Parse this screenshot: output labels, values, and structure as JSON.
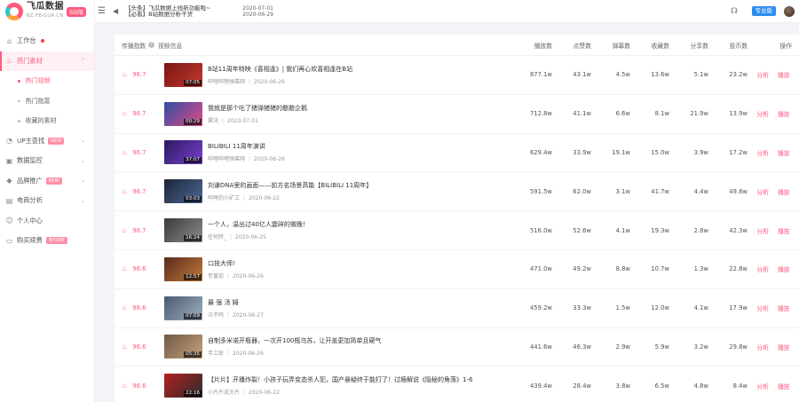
{
  "brand": {
    "name": "飞瓜数据",
    "sub": "BZ.FEIGUA.CN",
    "badge": "B站版"
  },
  "nav": [
    {
      "label": "工作台",
      "icon": "home-icon",
      "reddot": true
    },
    {
      "label": "热门素材",
      "icon": "fire-icon",
      "active": true,
      "caret": "⌃"
    },
    {
      "label": "UP主查找",
      "icon": "search-user-icon",
      "tag": "NEW",
      "caret": "⌄"
    },
    {
      "label": "数据监控",
      "icon": "monitor-icon",
      "caret": "⌄"
    },
    {
      "label": "品牌推广",
      "icon": "diamond-icon",
      "tag": "NEW",
      "caret": "⌄"
    },
    {
      "label": "电商分析",
      "icon": "cart-icon",
      "caret": "⌄"
    },
    {
      "label": "个人中心",
      "icon": "user-icon"
    },
    {
      "label": "购买续费",
      "icon": "card-icon",
      "tag": "年付8折"
    }
  ],
  "subnav": [
    "热门视频",
    "热门指富",
    "收藏的素材"
  ],
  "topbar": {
    "ticker_line1": "【头条】飞瓜数据上线新功能啦~",
    "ticker_line2": "【必看】B站数据分析干货",
    "date_line1": "2020-07-01",
    "date_line2": "2020-06-29",
    "pro_label": "专业版"
  },
  "table": {
    "headers": {
      "idx": "传播指数",
      "info": "视频信息",
      "play": "播放数",
      "like": "点赞数",
      "coin": "弹幕数",
      "fav": "收藏数",
      "share": "分享数",
      "coins": "投币数",
      "ops": "操作"
    },
    "op_analyze": "分析",
    "op_play": "播放",
    "rows": [
      {
        "idx": "96.7",
        "title": "B站11周年特映《喜相逢》| 我们再心欢喜相逢在B站",
        "author": "哔哩哔哩弹幕网",
        "date": "2020-06-26",
        "dur": "07:05",
        "play": "877.1w",
        "like": "43.1w",
        "coin": "4.5w",
        "fav": "13.6w",
        "share": "5.1w",
        "coins": "23.2w",
        "thumb": [
          "#7a1414",
          "#c23a2e"
        ]
      },
      {
        "idx": "96.7",
        "title": "我就是那个吃了猪弹猪猪的憨憨企鹅",
        "author": "翼讯",
        "date": "2020-07-01",
        "dur": "00:29",
        "play": "712.8w",
        "like": "41.1w",
        "coin": "6.6w",
        "fav": "8.1w",
        "share": "21.9w",
        "coins": "13.9w",
        "thumb": [
          "#2f4fa3",
          "#e04a86"
        ]
      },
      {
        "idx": "96.7",
        "title": "BILIBILI 11周年演讲",
        "author": "哔哩哔哩弹幕网",
        "date": "2020-06-26",
        "dur": "37:07",
        "play": "629.4w",
        "like": "33.9w",
        "coin": "19.1w",
        "fav": "15.0w",
        "share": "3.9w",
        "coins": "17.2w",
        "thumb": [
          "#2a1a5e",
          "#7a3fd1"
        ]
      },
      {
        "idx": "96.7",
        "title": "刘谦DNA里的画面——前方名场景高能【BILIBILI 11周年】",
        "author": "哔哩的小矿工",
        "date": "2020-06-22",
        "dur": "03:03",
        "play": "591.5w",
        "like": "62.0w",
        "coin": "3.1w",
        "fav": "41.7w",
        "share": "4.4w",
        "coins": "49.8w",
        "thumb": [
          "#1c2436",
          "#4d6a9a"
        ]
      },
      {
        "idx": "96.7",
        "title": "一个人，温出过40亿人震碎的微晚！",
        "author": "任何转_",
        "date": "2020-06-25",
        "dur": "16:24",
        "play": "516.0w",
        "like": "52.6w",
        "coin": "4.1w",
        "fav": "19.3w",
        "share": "2.8w",
        "coins": "42.3w",
        "thumb": [
          "#3a3a3a",
          "#8d8d8d"
        ]
      },
      {
        "idx": "96.6",
        "title": "口技大师!",
        "author": "老番茄",
        "date": "2020-06-26",
        "dur": "12:57",
        "play": "471.0w",
        "like": "49.2w",
        "coin": "8.8w",
        "fav": "10.7w",
        "share": "1.3w",
        "coins": "22.8w",
        "thumb": [
          "#5a2c1c",
          "#c07a3a"
        ]
      },
      {
        "idx": "96.6",
        "title": "最 强 汤 姆",
        "author": "汪不鸣",
        "date": "2020-06-27",
        "dur": "07:09",
        "play": "459.2w",
        "like": "33.3w",
        "coin": "1.5w",
        "fav": "12.0w",
        "share": "4.1w",
        "coins": "17.9w",
        "thumb": [
          "#4a5a6e",
          "#9fb0c0"
        ]
      },
      {
        "idx": "96.6",
        "title": "自制多米诺开瓶器，一次开100瓶乌苏，让开盖更加简单且硬气",
        "author": "手工耿",
        "date": "2020-06-26",
        "dur": "05:35",
        "play": "441.6w",
        "like": "46.3w",
        "coin": "2.9w",
        "fav": "5.9w",
        "share": "3.2w",
        "coins": "29.8w",
        "thumb": [
          "#6e5a46",
          "#c7a27a"
        ]
      },
      {
        "idx": "96.6",
        "title": "【片片】开播炸裂！小孩子玩弄变态杀人犯，国产悬疑终于能打了！过瘾解说《隐秘的角落》1-6",
        "author": "小片片说大片",
        "date": "2020-06-22",
        "dur": "22:16",
        "play": "439.4w",
        "like": "28.4w",
        "coin": "3.8w",
        "fav": "6.5w",
        "share": "4.8w",
        "coins": "8.4w",
        "thumb": [
          "#b31f1f",
          "#2d2d2d"
        ]
      }
    ]
  }
}
